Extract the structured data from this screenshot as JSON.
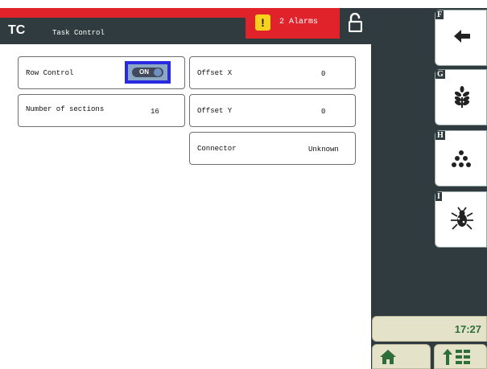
{
  "header": {
    "app_short": "TC",
    "title": "Task Control"
  },
  "alarm": {
    "icon": "warning-icon",
    "symbol": "!",
    "text": "2 Alarms",
    "color": "#e0222a"
  },
  "lock": {
    "icon": "unlocked-padlock-icon"
  },
  "left_cards": [
    {
      "label": "Row Control",
      "toggle": {
        "state": "ON"
      }
    },
    {
      "label": "Number of sections",
      "value": "16"
    }
  ],
  "right_cards": [
    {
      "label": "Offset X",
      "value": "0"
    },
    {
      "label": "Offset Y",
      "value": "0"
    },
    {
      "label": "Connector",
      "value": "Unknown"
    }
  ],
  "softkeys": [
    {
      "key": "F",
      "icon": "back-arrow-icon"
    },
    {
      "key": "G",
      "icon": "wheat-icon"
    },
    {
      "key": "H",
      "icon": "seeds-icon"
    },
    {
      "key": "I",
      "icon": "bug-icon"
    }
  ],
  "clock": {
    "time": "17:27"
  },
  "bottom_buttons": [
    {
      "icon": "home-icon"
    },
    {
      "icon": "up-arrow-grid-icon"
    }
  ],
  "colors": {
    "header_bg": "#2f3b3e",
    "accent_red": "#e0222a",
    "clock_text": "#2e6e3a",
    "toggle_border": "#2a2ae0"
  }
}
